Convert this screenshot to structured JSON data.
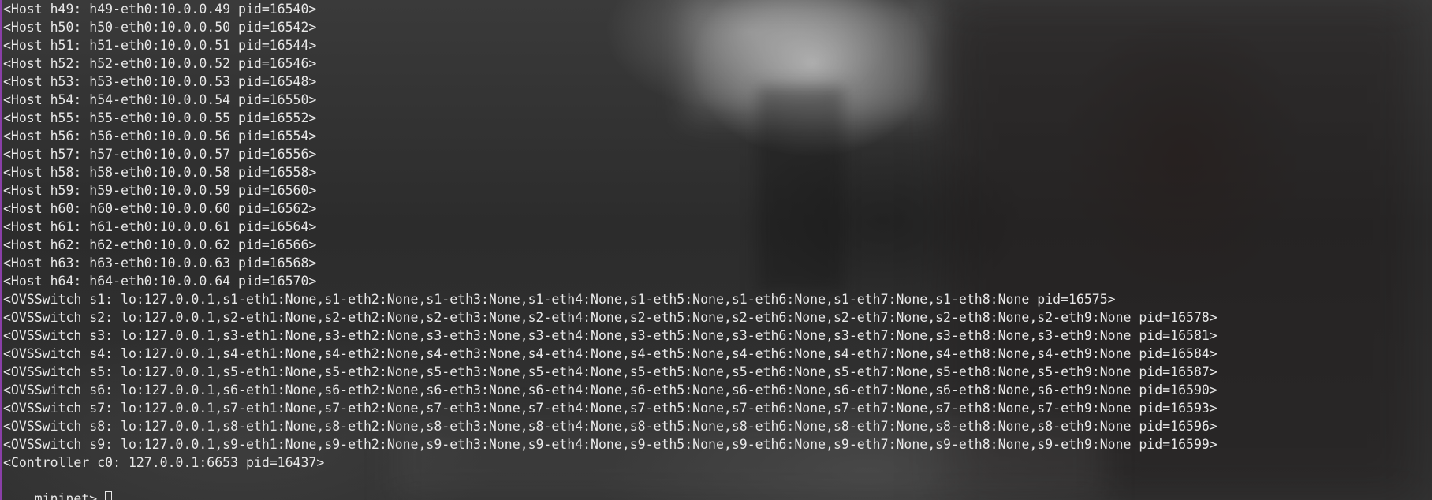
{
  "terminal": {
    "output_lines": [
      "<Host h49: h49-eth0:10.0.0.49 pid=16540>",
      "<Host h50: h50-eth0:10.0.0.50 pid=16542>",
      "<Host h51: h51-eth0:10.0.0.51 pid=16544>",
      "<Host h52: h52-eth0:10.0.0.52 pid=16546>",
      "<Host h53: h53-eth0:10.0.0.53 pid=16548>",
      "<Host h54: h54-eth0:10.0.0.54 pid=16550>",
      "<Host h55: h55-eth0:10.0.0.55 pid=16552>",
      "<Host h56: h56-eth0:10.0.0.56 pid=16554>",
      "<Host h57: h57-eth0:10.0.0.57 pid=16556>",
      "<Host h58: h58-eth0:10.0.0.58 pid=16558>",
      "<Host h59: h59-eth0:10.0.0.59 pid=16560>",
      "<Host h60: h60-eth0:10.0.0.60 pid=16562>",
      "<Host h61: h61-eth0:10.0.0.61 pid=16564>",
      "<Host h62: h62-eth0:10.0.0.62 pid=16566>",
      "<Host h63: h63-eth0:10.0.0.63 pid=16568>",
      "<Host h64: h64-eth0:10.0.0.64 pid=16570>",
      "<OVSSwitch s1: lo:127.0.0.1,s1-eth1:None,s1-eth2:None,s1-eth3:None,s1-eth4:None,s1-eth5:None,s1-eth6:None,s1-eth7:None,s1-eth8:None pid=16575>",
      "<OVSSwitch s2: lo:127.0.0.1,s2-eth1:None,s2-eth2:None,s2-eth3:None,s2-eth4:None,s2-eth5:None,s2-eth6:None,s2-eth7:None,s2-eth8:None,s2-eth9:None pid=16578>",
      "<OVSSwitch s3: lo:127.0.0.1,s3-eth1:None,s3-eth2:None,s3-eth3:None,s3-eth4:None,s3-eth5:None,s3-eth6:None,s3-eth7:None,s3-eth8:None,s3-eth9:None pid=16581>",
      "<OVSSwitch s4: lo:127.0.0.1,s4-eth1:None,s4-eth2:None,s4-eth3:None,s4-eth4:None,s4-eth5:None,s4-eth6:None,s4-eth7:None,s4-eth8:None,s4-eth9:None pid=16584>",
      "<OVSSwitch s5: lo:127.0.0.1,s5-eth1:None,s5-eth2:None,s5-eth3:None,s5-eth4:None,s5-eth5:None,s5-eth6:None,s5-eth7:None,s5-eth8:None,s5-eth9:None pid=16587>",
      "<OVSSwitch s6: lo:127.0.0.1,s6-eth1:None,s6-eth2:None,s6-eth3:None,s6-eth4:None,s6-eth5:None,s6-eth6:None,s6-eth7:None,s6-eth8:None,s6-eth9:None pid=16590>",
      "<OVSSwitch s7: lo:127.0.0.1,s7-eth1:None,s7-eth2:None,s7-eth3:None,s7-eth4:None,s7-eth5:None,s7-eth6:None,s7-eth7:None,s7-eth8:None,s7-eth9:None pid=16593>",
      "<OVSSwitch s8: lo:127.0.0.1,s8-eth1:None,s8-eth2:None,s8-eth3:None,s8-eth4:None,s8-eth5:None,s8-eth6:None,s8-eth7:None,s8-eth8:None,s8-eth9:None pid=16596>",
      "<OVSSwitch s9: lo:127.0.0.1,s9-eth1:None,s9-eth2:None,s9-eth3:None,s9-eth4:None,s9-eth5:None,s9-eth6:None,s9-eth7:None,s9-eth8:None,s9-eth9:None pid=16599>",
      "<Controller c0: 127.0.0.1:6653 pid=16437>"
    ],
    "prompt": "mininet> ",
    "input_value": ""
  },
  "colors": {
    "text": "#e8e8e8",
    "accent_border": "#8a3fa8"
  }
}
